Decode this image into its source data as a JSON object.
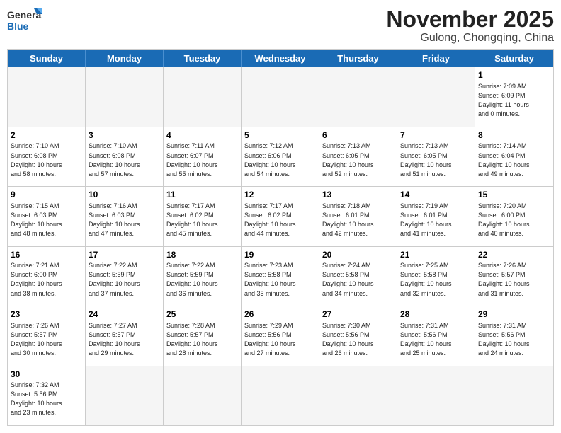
{
  "header": {
    "logo_general": "General",
    "logo_blue": "Blue",
    "month_title": "November 2025",
    "location": "Gulong, Chongqing, China"
  },
  "day_headers": [
    "Sunday",
    "Monday",
    "Tuesday",
    "Wednesday",
    "Thursday",
    "Friday",
    "Saturday"
  ],
  "weeks": [
    [
      {
        "num": "",
        "info": "",
        "empty": true
      },
      {
        "num": "",
        "info": "",
        "empty": true
      },
      {
        "num": "",
        "info": "",
        "empty": true
      },
      {
        "num": "",
        "info": "",
        "empty": true
      },
      {
        "num": "",
        "info": "",
        "empty": true
      },
      {
        "num": "",
        "info": "",
        "empty": true
      },
      {
        "num": "1",
        "info": "Sunrise: 7:09 AM\nSunset: 6:09 PM\nDaylight: 11 hours\nand 0 minutes.",
        "empty": false
      }
    ],
    [
      {
        "num": "2",
        "info": "Sunrise: 7:10 AM\nSunset: 6:08 PM\nDaylight: 10 hours\nand 58 minutes.",
        "empty": false
      },
      {
        "num": "3",
        "info": "Sunrise: 7:10 AM\nSunset: 6:08 PM\nDaylight: 10 hours\nand 57 minutes.",
        "empty": false
      },
      {
        "num": "4",
        "info": "Sunrise: 7:11 AM\nSunset: 6:07 PM\nDaylight: 10 hours\nand 55 minutes.",
        "empty": false
      },
      {
        "num": "5",
        "info": "Sunrise: 7:12 AM\nSunset: 6:06 PM\nDaylight: 10 hours\nand 54 minutes.",
        "empty": false
      },
      {
        "num": "6",
        "info": "Sunrise: 7:13 AM\nSunset: 6:05 PM\nDaylight: 10 hours\nand 52 minutes.",
        "empty": false
      },
      {
        "num": "7",
        "info": "Sunrise: 7:13 AM\nSunset: 6:05 PM\nDaylight: 10 hours\nand 51 minutes.",
        "empty": false
      },
      {
        "num": "8",
        "info": "Sunrise: 7:14 AM\nSunset: 6:04 PM\nDaylight: 10 hours\nand 49 minutes.",
        "empty": false
      }
    ],
    [
      {
        "num": "9",
        "info": "Sunrise: 7:15 AM\nSunset: 6:03 PM\nDaylight: 10 hours\nand 48 minutes.",
        "empty": false
      },
      {
        "num": "10",
        "info": "Sunrise: 7:16 AM\nSunset: 6:03 PM\nDaylight: 10 hours\nand 47 minutes.",
        "empty": false
      },
      {
        "num": "11",
        "info": "Sunrise: 7:17 AM\nSunset: 6:02 PM\nDaylight: 10 hours\nand 45 minutes.",
        "empty": false
      },
      {
        "num": "12",
        "info": "Sunrise: 7:17 AM\nSunset: 6:02 PM\nDaylight: 10 hours\nand 44 minutes.",
        "empty": false
      },
      {
        "num": "13",
        "info": "Sunrise: 7:18 AM\nSunset: 6:01 PM\nDaylight: 10 hours\nand 42 minutes.",
        "empty": false
      },
      {
        "num": "14",
        "info": "Sunrise: 7:19 AM\nSunset: 6:01 PM\nDaylight: 10 hours\nand 41 minutes.",
        "empty": false
      },
      {
        "num": "15",
        "info": "Sunrise: 7:20 AM\nSunset: 6:00 PM\nDaylight: 10 hours\nand 40 minutes.",
        "empty": false
      }
    ],
    [
      {
        "num": "16",
        "info": "Sunrise: 7:21 AM\nSunset: 6:00 PM\nDaylight: 10 hours\nand 38 minutes.",
        "empty": false
      },
      {
        "num": "17",
        "info": "Sunrise: 7:22 AM\nSunset: 5:59 PM\nDaylight: 10 hours\nand 37 minutes.",
        "empty": false
      },
      {
        "num": "18",
        "info": "Sunrise: 7:22 AM\nSunset: 5:59 PM\nDaylight: 10 hours\nand 36 minutes.",
        "empty": false
      },
      {
        "num": "19",
        "info": "Sunrise: 7:23 AM\nSunset: 5:58 PM\nDaylight: 10 hours\nand 35 minutes.",
        "empty": false
      },
      {
        "num": "20",
        "info": "Sunrise: 7:24 AM\nSunset: 5:58 PM\nDaylight: 10 hours\nand 34 minutes.",
        "empty": false
      },
      {
        "num": "21",
        "info": "Sunrise: 7:25 AM\nSunset: 5:58 PM\nDaylight: 10 hours\nand 32 minutes.",
        "empty": false
      },
      {
        "num": "22",
        "info": "Sunrise: 7:26 AM\nSunset: 5:57 PM\nDaylight: 10 hours\nand 31 minutes.",
        "empty": false
      }
    ],
    [
      {
        "num": "23",
        "info": "Sunrise: 7:26 AM\nSunset: 5:57 PM\nDaylight: 10 hours\nand 30 minutes.",
        "empty": false
      },
      {
        "num": "24",
        "info": "Sunrise: 7:27 AM\nSunset: 5:57 PM\nDaylight: 10 hours\nand 29 minutes.",
        "empty": false
      },
      {
        "num": "25",
        "info": "Sunrise: 7:28 AM\nSunset: 5:57 PM\nDaylight: 10 hours\nand 28 minutes.",
        "empty": false
      },
      {
        "num": "26",
        "info": "Sunrise: 7:29 AM\nSunset: 5:56 PM\nDaylight: 10 hours\nand 27 minutes.",
        "empty": false
      },
      {
        "num": "27",
        "info": "Sunrise: 7:30 AM\nSunset: 5:56 PM\nDaylight: 10 hours\nand 26 minutes.",
        "empty": false
      },
      {
        "num": "28",
        "info": "Sunrise: 7:31 AM\nSunset: 5:56 PM\nDaylight: 10 hours\nand 25 minutes.",
        "empty": false
      },
      {
        "num": "29",
        "info": "Sunrise: 7:31 AM\nSunset: 5:56 PM\nDaylight: 10 hours\nand 24 minutes.",
        "empty": false
      }
    ],
    [
      {
        "num": "30",
        "info": "Sunrise: 7:32 AM\nSunset: 5:56 PM\nDaylight: 10 hours\nand 23 minutes.",
        "empty": false
      },
      {
        "num": "",
        "info": "",
        "empty": true
      },
      {
        "num": "",
        "info": "",
        "empty": true
      },
      {
        "num": "",
        "info": "",
        "empty": true
      },
      {
        "num": "",
        "info": "",
        "empty": true
      },
      {
        "num": "",
        "info": "",
        "empty": true
      },
      {
        "num": "",
        "info": "",
        "empty": true
      }
    ]
  ]
}
